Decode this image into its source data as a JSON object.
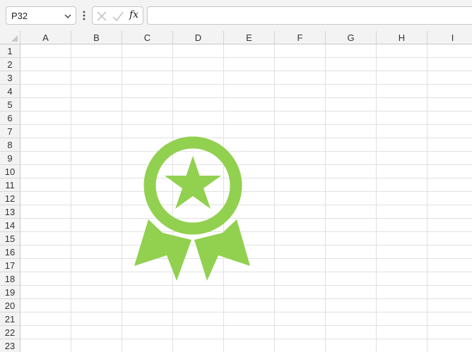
{
  "formula_bar": {
    "name_box": "P32",
    "name_box_icon": "chevron-down-icon",
    "more_icon": "vertical-ellipsis-icon",
    "cancel_icon": "close-icon",
    "enter_icon": "checkmark-icon",
    "fx_label": "fx",
    "formula_value": ""
  },
  "grid": {
    "columns": [
      "A",
      "B",
      "C",
      "D",
      "E",
      "F",
      "G",
      "H",
      "I"
    ],
    "rows": [
      "1",
      "2",
      "3",
      "4",
      "5",
      "6",
      "7",
      "8",
      "9",
      "10",
      "11",
      "12",
      "13",
      "14",
      "15",
      "16",
      "17",
      "18",
      "19",
      "20",
      "21",
      "22",
      "23"
    ]
  },
  "picture": {
    "icon": "award-ribbon-icon",
    "color": "#92d050"
  },
  "colors": {
    "header_bg": "#f3f3f3",
    "gridline": "#e1e1e1"
  }
}
